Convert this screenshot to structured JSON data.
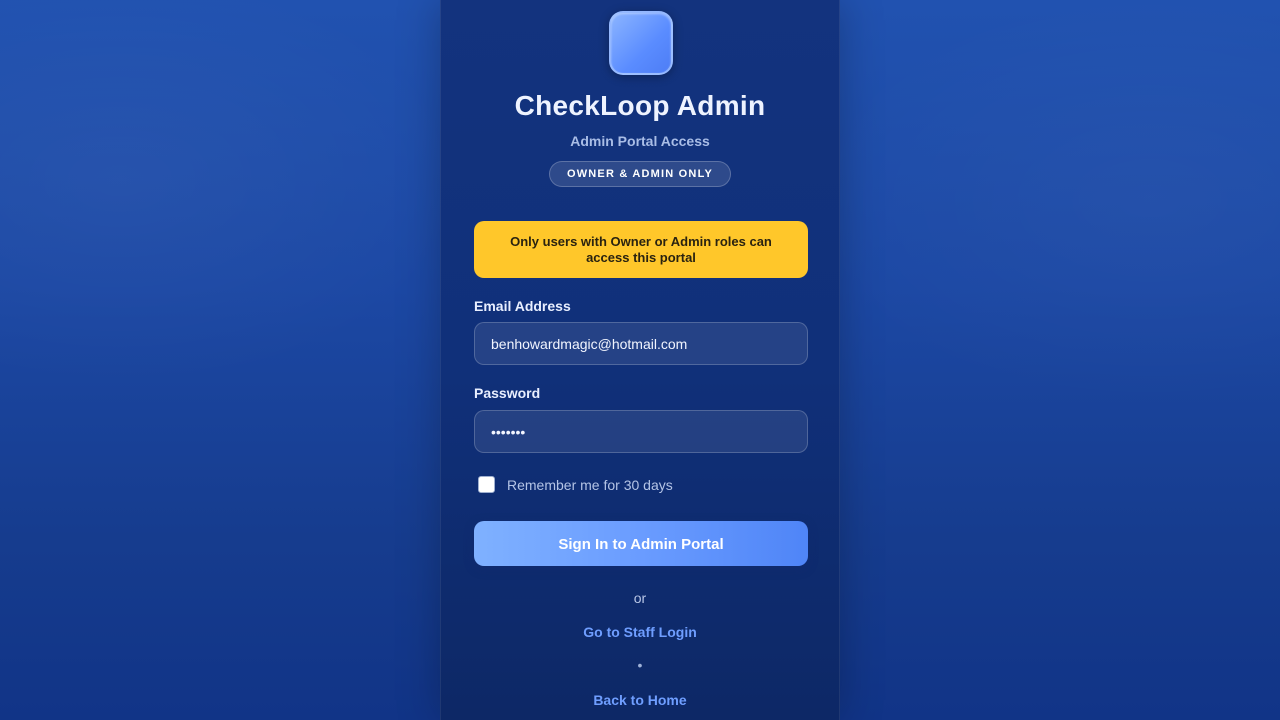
{
  "app": {
    "title": "CheckLoop Admin",
    "subtitle": "Admin Portal Access",
    "badge": "OWNER & ADMIN ONLY",
    "logo_icon": "app-logo-icon"
  },
  "notice": {
    "text": "Only users with Owner or Admin roles can access this portal",
    "color": "#ffc72a"
  },
  "form": {
    "email_label": "Email Address",
    "email_value": "benhowardmagic@hotmail.com",
    "password_label": "Password",
    "password_value": "•••••••",
    "remember_label": "Remember me for 30 days",
    "remember_checked": false,
    "submit_label": "Sign In to Admin Portal"
  },
  "footer": {
    "or_text": "or",
    "staff_link": "Go to Staff Login",
    "separator": "•",
    "home_link": "Back to Home"
  },
  "colors": {
    "background": "#1c48a4",
    "card": "#10307a",
    "accent": "#6a9cff",
    "link": "#6f9eff"
  }
}
